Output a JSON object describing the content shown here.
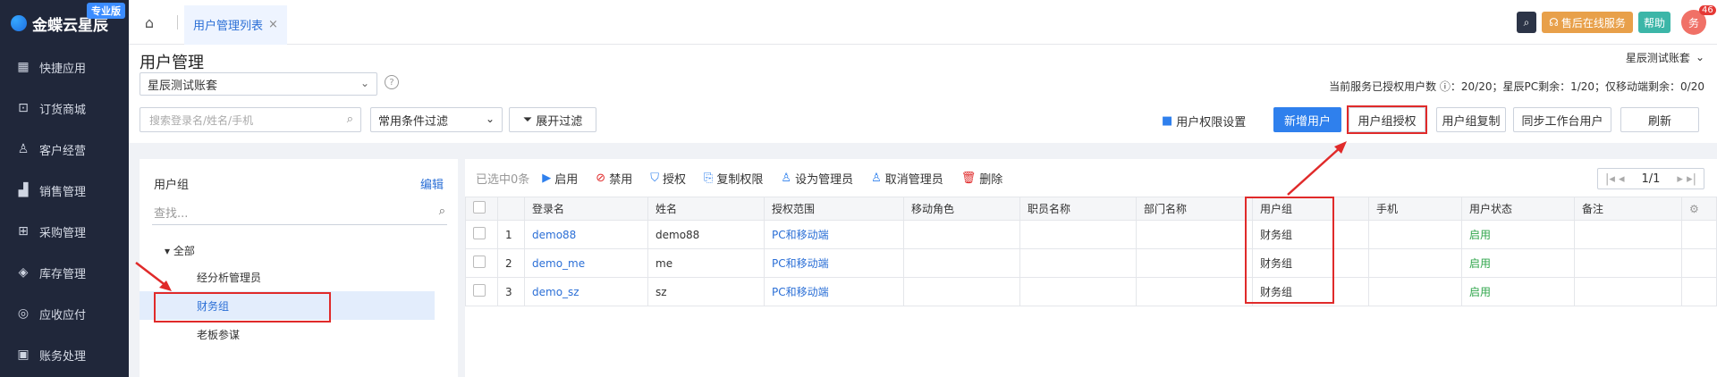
{
  "sidebar": {
    "logo_text": "金蝶云星辰",
    "edition_badge": "专业版",
    "items": [
      {
        "label": "快捷应用",
        "icon": "grid-icon"
      },
      {
        "label": "订货商城",
        "icon": "shop-icon"
      },
      {
        "label": "客户经营",
        "icon": "user-icon"
      },
      {
        "label": "销售管理",
        "icon": "chart-icon"
      },
      {
        "label": "采购管理",
        "icon": "cart-icon"
      },
      {
        "label": "库存管理",
        "icon": "box-icon"
      },
      {
        "label": "应收应付",
        "icon": "money-icon"
      },
      {
        "label": "账务处理",
        "icon": "ledger-icon"
      }
    ]
  },
  "topbar": {
    "tab_label": "用户管理列表",
    "service_label": "售后在线服务",
    "help_label": "帮助",
    "avatar_text": "务",
    "notification_count": "46"
  },
  "header": {
    "title": "用户管理",
    "account": "星辰测试账套",
    "account_right": "星辰测试账套",
    "license_text": "当前服务已授权用户数 ⓘ：20/20；星辰PC剩余：1/20；仅移动端剩余：0/20"
  },
  "filters": {
    "search_placeholder": "搜索登录名/姓名/手机",
    "filter_select": "常用条件过滤",
    "expand_label": "展开过滤"
  },
  "actions": {
    "perm_setting": "用户权限设置",
    "add_user": "新增用户",
    "group_auth": "用户组授权",
    "group_copy": "用户组复制",
    "sync_users": "同步工作台用户",
    "refresh": "刷新"
  },
  "groups": {
    "title": "用户组",
    "edit": "编辑",
    "search_placeholder": "查找...",
    "root": "全部",
    "items": [
      "经分析管理员",
      "财务组",
      "老板参谋"
    ],
    "selected": "财务组"
  },
  "toolbar": {
    "selected_count": "已选中0条",
    "enable": "启用",
    "disable": "禁用",
    "grant": "授权",
    "copy_perm": "复制权限",
    "set_admin": "设为管理员",
    "cancel_admin": "取消管理员",
    "delete": "删除",
    "page": "1/1"
  },
  "table": {
    "columns": [
      "登录名",
      "姓名",
      "授权范围",
      "移动角色",
      "职员名称",
      "部门名称",
      "用户组",
      "手机",
      "用户状态",
      "备注"
    ],
    "rows": [
      {
        "no": "1",
        "login": "demo88",
        "name": "demo88",
        "scope": "PC和移动端",
        "mobile_role": "",
        "staff": "",
        "dept": "",
        "group": "财务组",
        "phone": "",
        "status": "启用",
        "note": ""
      },
      {
        "no": "2",
        "login": "demo_me",
        "name": "me",
        "scope": "PC和移动端",
        "mobile_role": "",
        "staff": "",
        "dept": "",
        "group": "财务组",
        "phone": "",
        "status": "启用",
        "note": ""
      },
      {
        "no": "3",
        "login": "demo_sz",
        "name": "sz",
        "scope": "PC和移动端",
        "mobile_role": "",
        "staff": "",
        "dept": "",
        "group": "财务组",
        "phone": "",
        "status": "启用",
        "note": ""
      }
    ]
  },
  "colors": {
    "accent": "#2f80ed",
    "annotation": "#e02a2a",
    "enabled": "#2ea54a"
  }
}
